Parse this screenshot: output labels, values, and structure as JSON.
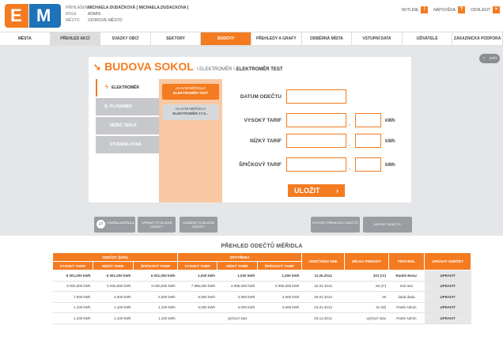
{
  "header": {
    "logged_label": "PŘIHLÁŠEN",
    "logged_value": "MICHAELA DUDÁČKOVÁ [ MICHAELA.DUDACKOVA ]",
    "role_label": "ROLE",
    "role_value": "ADMIN",
    "city_label": "MĚSTO",
    "city_value": "VZOROVÉ MĚSTO",
    "hotline": "HOTLINE",
    "help": "NÁPOVĚDA",
    "logout": "ODHLÁSIT",
    "logo_e": "E",
    "logo_m": "M"
  },
  "nav": [
    "MĚSTA",
    "PŘEHLED AKCÍ",
    "SVAZKY OBCÍ",
    "SEKTORY",
    "BUDOVY",
    "PŘEHLEDY A GRAFY",
    "ODBĚRNÁ MÍSTA",
    "VSTUPNÍ DATA",
    "UŽIVATELÉ",
    "ZÁKAZNICKÁ PODPORA"
  ],
  "back_label": "ZPĚT",
  "title": {
    "building": "BUDOVA SOKOL",
    "crumb1": "\\ ELEKTROMĚR \\",
    "crumb2": "ELEKTROMĚR TEST"
  },
  "tabs": [
    "ELEKTROMĚR",
    "PLYNOMĚR",
    "MĚŘIČ TEPLA",
    "STUDENÁ VODA"
  ],
  "meters": [
    {
      "l1": "HLAVNÍ MĚŘIDLO",
      "l2": "ELEKTROMĚR TEST"
    },
    {
      "l1": "HLAVNÍ MĚŘIDLO",
      "l2": "ELEKTROMĚR 17.5..."
    }
  ],
  "form": {
    "date_label": "DATUM ODEČTU",
    "high_label": "VYSOKÝ TARIF",
    "low_label": "NÍZKÝ TARIF",
    "peak_label": "ŠPIČKOVÝ TARIF",
    "unit": "kWh",
    "comma": ",",
    "save": "ULOŽIT",
    "save_chevron": "›"
  },
  "actions": {
    "swap": "VÝMĚNA MĚŘIDLA",
    "edit_last": "UPRAVIT POSLEDNÍ ODEČET",
    "delete_last": "ODEBRAT POSLEDNÍ ODEČET",
    "export": "EXPORT PŘEHLEDU ODEČTŮ",
    "import": "IMPORT ODEČTŮ"
  },
  "table": {
    "title": "PŘEHLED ODEČTŮ MĚŘIDLA",
    "group1": "ODEČET (kWh)",
    "group2": "SPOTŘEBA",
    "cols": [
      "VYSOKÝ TARIF",
      "NÍZKÝ TARIF",
      "ŠPIČKOVÝ TARIF",
      "VYSOKÝ TARIF",
      "NÍZKÝ TARIF",
      "ŠPIČKOVÝ TARIF"
    ],
    "date_col": "ODEČTENO DNE",
    "period_col": "DÉLKA PERIODY",
    "by_col": "PROVEDL",
    "edit_col": "UPRAVIT ODEČET",
    "rows": [
      {
        "a": "8 001,000 kWh",
        "b": "5 001,000 kWh",
        "c": "6 001,000 kWh",
        "d": "1,000 kWh",
        "e": "1,000 kWh",
        "f": "1,000 kWh",
        "date": "11.05.2014",
        "period": "323 (!!!)",
        "by": "Radek Botur",
        "edit": "UPRAVIT",
        "bold": true
      },
      {
        "a": "8 000,000 kWh",
        "b": "5 000,000 kWh",
        "c": "6 000,000 kWh",
        "d": "7 995,000 kWh",
        "e": "4 996,000 kWh",
        "f": "5 995,000 kWh",
        "date": "22.04.2013",
        "period": "83 (!!!)",
        "by": "test test",
        "edit": "UPRAVIT",
        "bold": false
      },
      {
        "a": "7,000 kWh",
        "b": "4,000 kWh",
        "c": "5,000 kWh",
        "d": "5,900 kWh",
        "e": "2,900 kWh",
        "f": "3,900 kWh",
        "date": "29.01.2013",
        "period": "26",
        "by": "dada dada",
        "edit": "UPRAVIT",
        "bold": false
      },
      {
        "a": "1,100 kWh",
        "b": "1,100 kWh",
        "c": "1,100 kWh",
        "d": "0,000 kWh",
        "e": "0,000 kWh",
        "f": "0,000 kWh",
        "date": "03.01.2013",
        "period": "31 (M)",
        "by": "Patrik Admin",
        "edit": "UPRAVIT",
        "bold": false
      },
      {
        "a": "1,100 kWh",
        "b": "1,100 kWh",
        "c": "1,100 kWh",
        "d": "",
        "e": "výchozí stav",
        "f": "",
        "date": "03.12.2012",
        "period": "výchozí stav",
        "by": "Patrik Admin",
        "edit": "UPRAVIT",
        "bold": false
      }
    ]
  },
  "colors": {
    "accent": "#f47b20",
    "brand_blue": "#1d72b8",
    "panel": "#e4e6e8"
  }
}
